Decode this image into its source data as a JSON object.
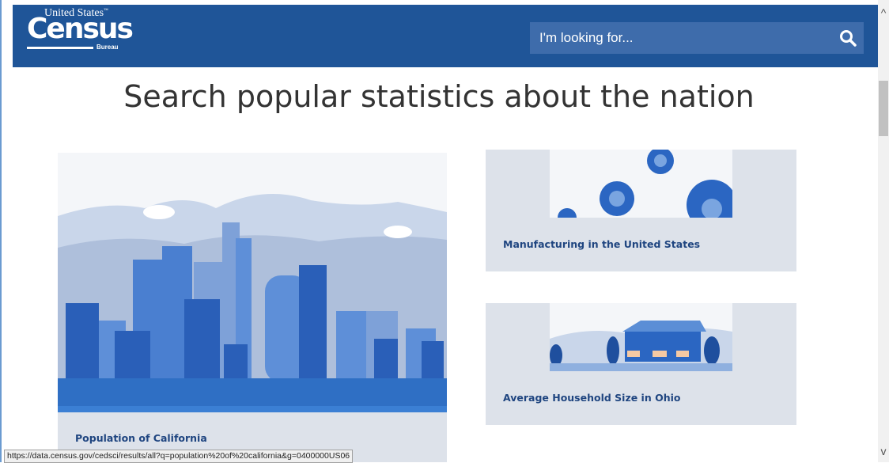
{
  "header": {
    "logo": {
      "line1": "United States",
      "line2": "Census",
      "line3": "Bureau",
      "tm": "™"
    },
    "search": {
      "placeholder": "I'm looking for...",
      "icon": "search-icon"
    }
  },
  "main": {
    "heading": "Search popular statistics about the nation",
    "cards": [
      {
        "label": "Population of California",
        "image": "city-skyline-illustration"
      },
      {
        "label": "Manufacturing in the United States",
        "image": "gears-illustration"
      },
      {
        "label": "Average Household Size in Ohio",
        "image": "house-illustration"
      }
    ]
  },
  "status_bar": {
    "url": "https://data.census.gov/cedsci/results/all?q=population%20of%20california&g=0400000US06"
  },
  "colors": {
    "header": "#1f5598",
    "search_bg": "#3e6cab",
    "card_bg": "#dde2ea",
    "card_text": "#1f4580",
    "heading": "#333333"
  }
}
